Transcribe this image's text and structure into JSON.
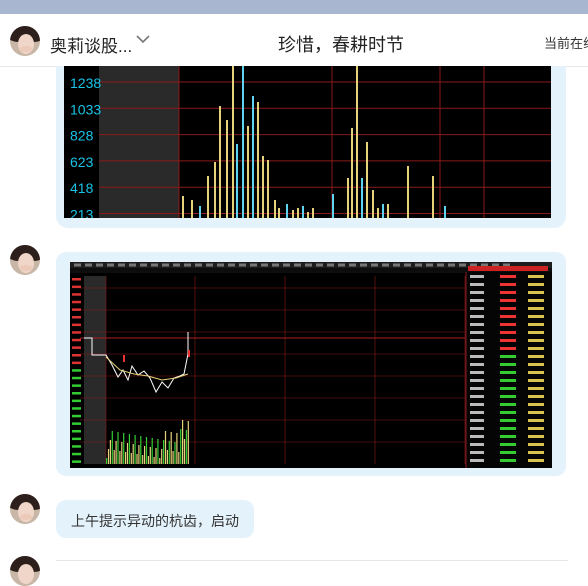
{
  "header": {
    "contact_name": "奥莉谈股...",
    "title": "珍惜，春耕时节",
    "status_text": "当前在线"
  },
  "icons": {
    "chevron": "chevron-down-icon",
    "avatar": "contact-avatar"
  },
  "colors": {
    "top_strip": "#a9b6cf",
    "bubble": "#e3f2fb",
    "chart_bg": "#000000",
    "grid_red": "#8a1a1a",
    "axis_cyan": "#19c3e6",
    "bar_yellow": "#e6d27a",
    "bar_cyan": "#5fd4f0"
  },
  "messages": [
    {
      "type": "image",
      "kind": "volume-chart-crop",
      "axis_labels": [
        "1238",
        "1033",
        "828",
        "623",
        "418",
        "213"
      ]
    },
    {
      "type": "image",
      "kind": "stock-terminal-screenshot"
    },
    {
      "type": "text",
      "text": "上午提示异动的杭齿，启动"
    }
  ]
}
